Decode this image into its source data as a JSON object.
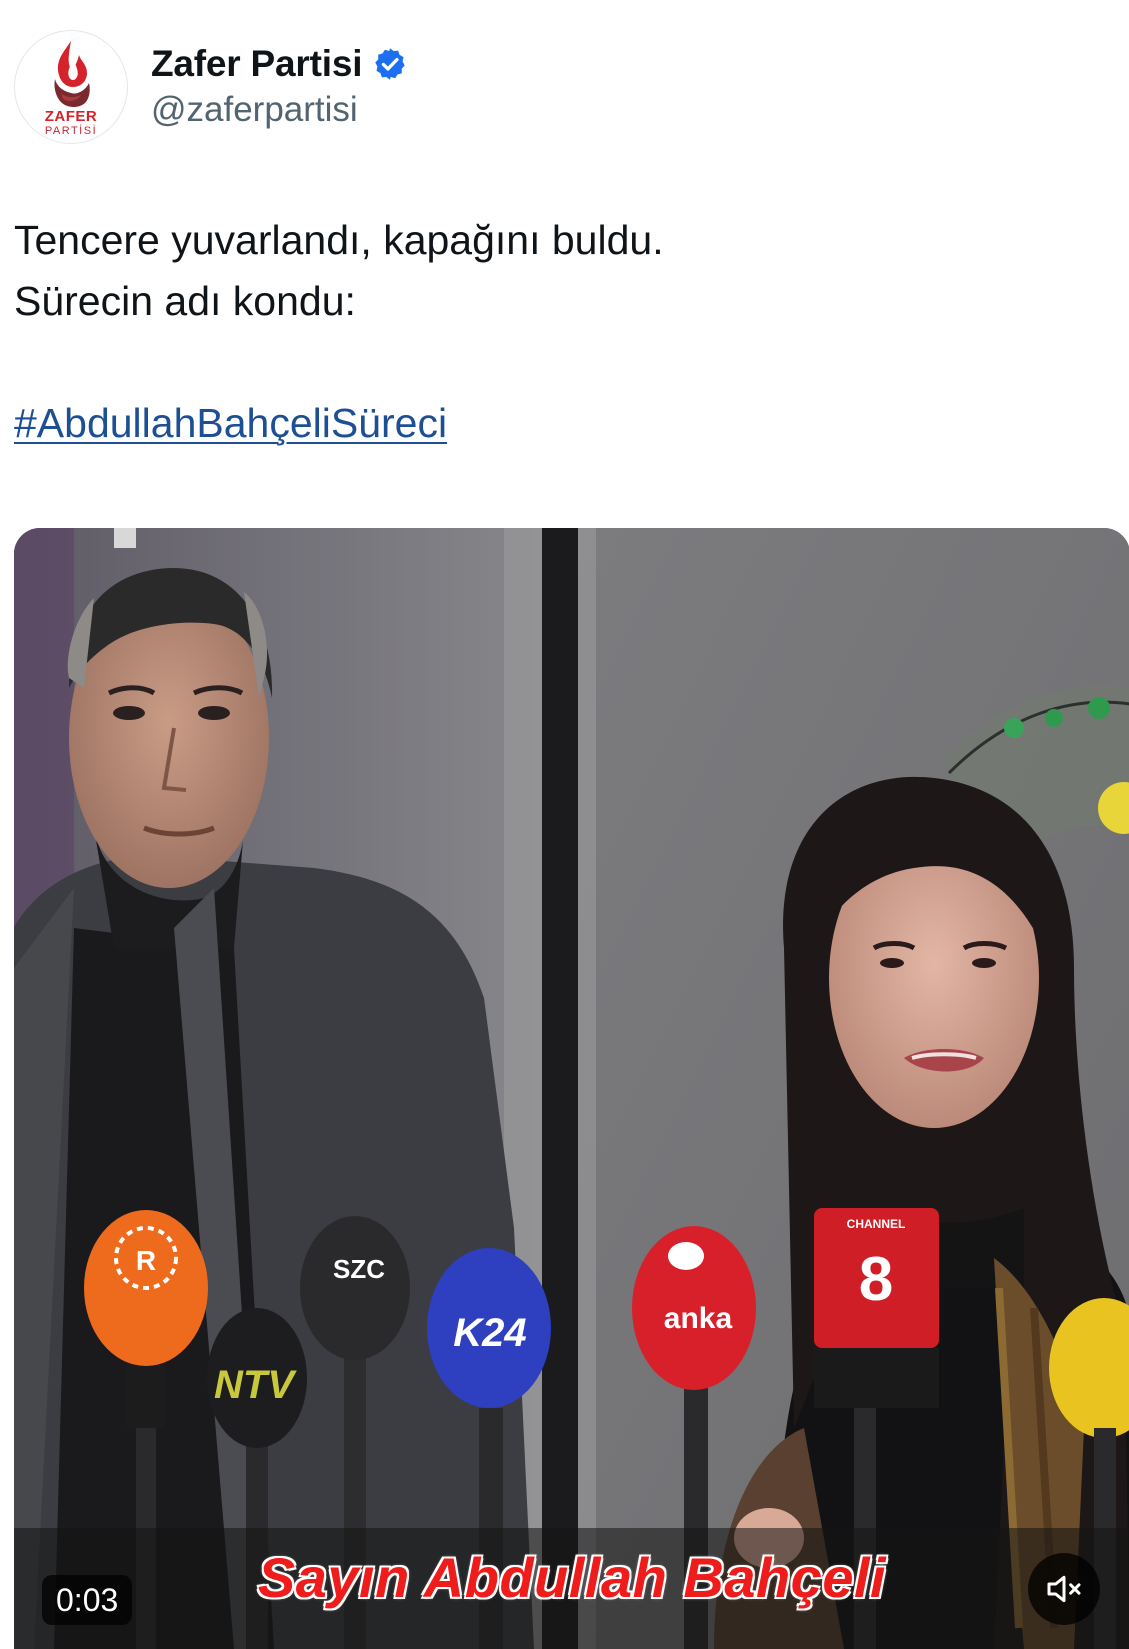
{
  "account": {
    "display_name": "Zafer Partisi",
    "handle": "@zaferpartisi",
    "verified": true,
    "verified_icon": "verified-badge-icon",
    "avatar": {
      "logo_line1": "ZAFER",
      "logo_line2": "PARTİSİ",
      "brand_color": "#d5232b"
    }
  },
  "tweet": {
    "line1": "Tencere yuvarlandı, kapağını buldu.",
    "line2": "Sürecin adı kondu:",
    "hashtag": "#AbdullahBahçeliSüreci",
    "hashtag_color": "#1d4f94"
  },
  "video": {
    "caption": "Sayın Abdullah Bahçeli",
    "caption_color": "#ef1c1c",
    "timestamp": "0:03",
    "muted": true,
    "mute_icon": "speaker-muted-icon",
    "mic_labels": {
      "rudaw": "R",
      "ntv": "NTV",
      "szc": "SZC",
      "k24": "K24",
      "anka": "anka",
      "channel8_top": "CHANNEL",
      "channel8_num": "8"
    }
  }
}
